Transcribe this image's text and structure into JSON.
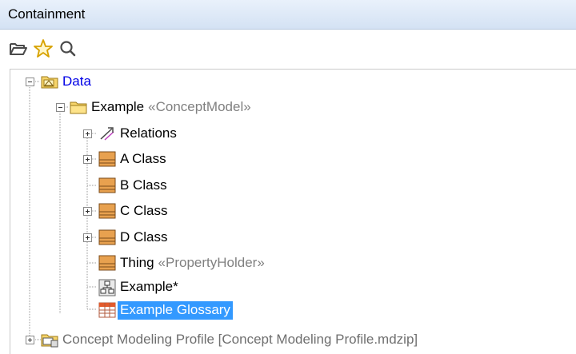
{
  "panel": {
    "title": "Containment"
  },
  "toolbar": {
    "icons": [
      "folder-open-icon",
      "star-icon",
      "search-icon"
    ]
  },
  "tree": {
    "root": {
      "label": "Data",
      "expanded": true
    },
    "example": {
      "label": "Example",
      "stereotype": "«ConceptModel»",
      "expanded": true
    },
    "relations": {
      "label": "Relations"
    },
    "a_class": {
      "label": "A Class"
    },
    "b_class": {
      "label": "B Class"
    },
    "c_class": {
      "label": "C Class"
    },
    "d_class": {
      "label": "D Class"
    },
    "thing": {
      "label": "Thing",
      "stereotype": "«PropertyHolder»"
    },
    "example_diagram": {
      "label": "Example*"
    },
    "example_glossary": {
      "label": "Example Glossary",
      "selected": true
    },
    "profile": {
      "label": "Concept Modeling Profile [Concept Modeling Profile.mdzip]"
    }
  },
  "colors": {
    "selection": "#3399ff",
    "root_label": "#0000e6",
    "stereotype": "#808080",
    "class_icon": "#e8a14f"
  }
}
